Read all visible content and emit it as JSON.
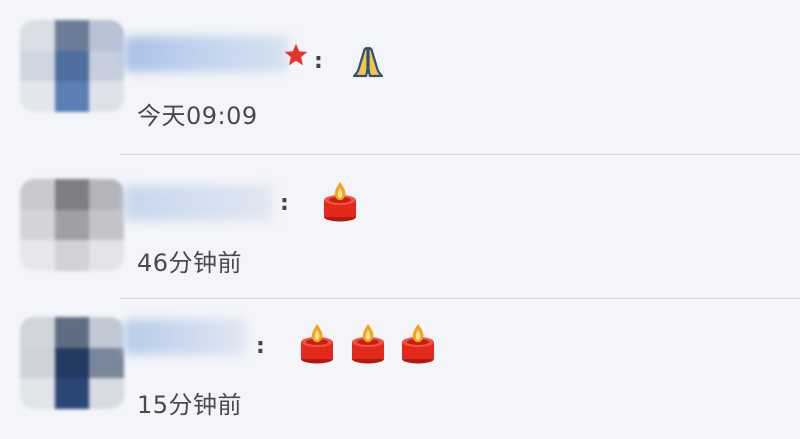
{
  "comments": [
    {
      "colon": ":",
      "reaction": [
        "pray-emoji"
      ],
      "badge_icon": "red-star-icon",
      "time": "今天09:09"
    },
    {
      "colon": ":",
      "reaction": [
        "candle-emoji"
      ],
      "time": "46分钟前"
    },
    {
      "colon": ":",
      "reaction": [
        "candle-emoji",
        "candle-emoji",
        "candle-emoji"
      ],
      "time": "15分钟前"
    }
  ]
}
